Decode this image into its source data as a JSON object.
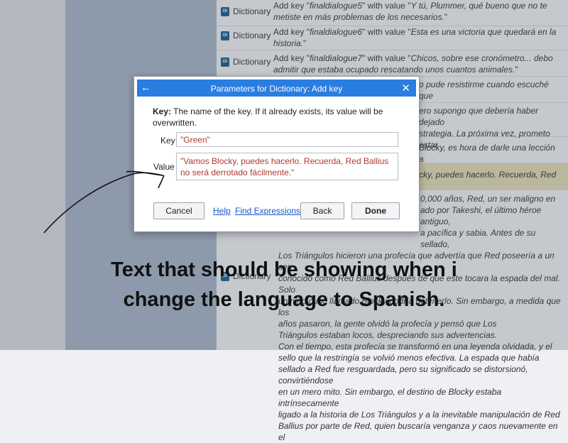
{
  "rows": [
    {
      "tag": "Dictionary",
      "pre": "Add key \"",
      "key": "finaldialogue5",
      "mid": "\" with value \"",
      "val": "Y tú, Plummer, qué bueno que no te metiste en más problemas de los necesarios.",
      "post": "\""
    },
    {
      "tag": "Dictionary",
      "pre": "Add key \"",
      "key": "finaldialogue6",
      "mid": "\" with value \"",
      "val": "Esta es una victoria que quedará en la historia.",
      "post": "\""
    },
    {
      "tag": "Dictionary",
      "pre": "Add key \"",
      "key": "finaldialogue7",
      "mid": "\" with value \"",
      "val": "Chicos, sobre ese cronómetro... debo admitir que estaba ocupado rescatando unos cuantos animales.",
      "post": "\""
    }
  ],
  "partial_rows": {
    "r4": "o pude resistirme cuando escuché que",
    "r5a": "ero supongo que debería haber dejado",
    "r5b": "strategia. La próxima vez, prometo estar",
    "r6": "Blocky, es hora de darle una lección a",
    "r7": "cky, puedes hacerlo. Recuerda, Red",
    "big_a": "0,000 años, Red, un ser maligno en",
    "big_b": "ado por Takeshi, el último héroe antiguo,",
    "big_c": "a pacífica y sabia. Antes de su sellado,",
    "big_d": "Los Triángulos hicieron una profecía que advertía que Red poseería a un ser",
    "big_e": "conocido como Red Ballius después de que este tocara la espada del mal. Solo",
    "big_f": "un niño cubo llamado Blocky podría detenerlo. Sin embargo, a medida que los",
    "big_g": "años pasaron, la gente olvidó la profecía y pensó que Los",
    "big_h": "Triángulos estaban locos, despreciando sus advertencias.",
    "big_i": "Con el tiempo, esta profecía se transformó en una leyenda olvidada, y el",
    "big_j": "sello que la restringía se volvió menos efectiva. La espada que había",
    "big_k": "sellado a Red fue resguardada, pero su significado se distorsionó, convirtiéndose",
    "big_l": "en un mero mito. Sin embargo, el destino de Blocky estaba intrínsecamente",
    "big_m": "ligado a la historia de Los Triángulos y a la inevitable manipulación de Red",
    "big_n": "Ballius por parte de Red, quien buscaría venganza y caos nuevamente en el",
    "big_tag": "Dictionary"
  },
  "dialog": {
    "title": "Parameters for Dictionary: Add key",
    "desc_bold": "Key:",
    "desc_text": " The name of the key. If it already exists, its value will be overwritten.",
    "key_label": "Key",
    "key_value": "\"Green\"",
    "value_label": "Value",
    "value_value": "\"Vamos Blocky, puedes hacerlo. Recuerda, Red Ballius no será derrotado fácilmente.\"",
    "cancel": "Cancel",
    "help": "Help",
    "find": "Find Expressions",
    "back": "Back",
    "done": "Done"
  },
  "caption": {
    "line1": "Text that should be showing when i",
    "line2": "change the language to Spanish."
  },
  "colors": {
    "accent": "#2a7de1",
    "value_text": "#b03a2e",
    "highlight": "#e9dfb5"
  }
}
